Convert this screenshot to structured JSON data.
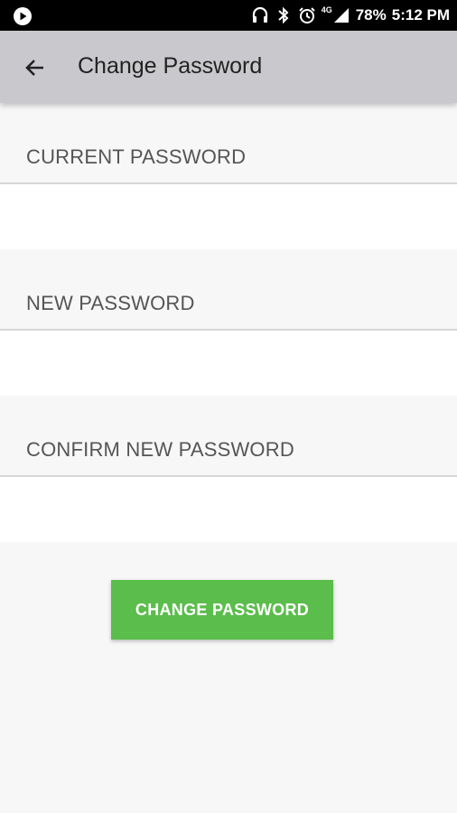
{
  "status_bar": {
    "left_icon": "play-circle-icon",
    "icons": [
      "headphones-icon",
      "bluetooth-icon",
      "alarm-icon",
      "signal-icon"
    ],
    "network": "4G",
    "battery": "78%",
    "time": "5:12 PM"
  },
  "app_bar": {
    "back_icon": "arrow-left-icon",
    "title": "Change Password"
  },
  "form": {
    "fields": [
      {
        "label": "CURRENT PASSWORD",
        "value": "",
        "placeholder": ""
      },
      {
        "label": "NEW PASSWORD",
        "value": "",
        "placeholder": ""
      },
      {
        "label": "CONFIRM NEW PASSWORD",
        "value": "",
        "placeholder": ""
      }
    ],
    "submit_label": "CHANGE PASSWORD"
  },
  "colors": {
    "status_bar": "#000000",
    "app_bar": "#c9c9cd",
    "background": "#fafafa",
    "button": "#5bbd4b",
    "button_text": "#ffffff",
    "label_text": "#555555"
  }
}
